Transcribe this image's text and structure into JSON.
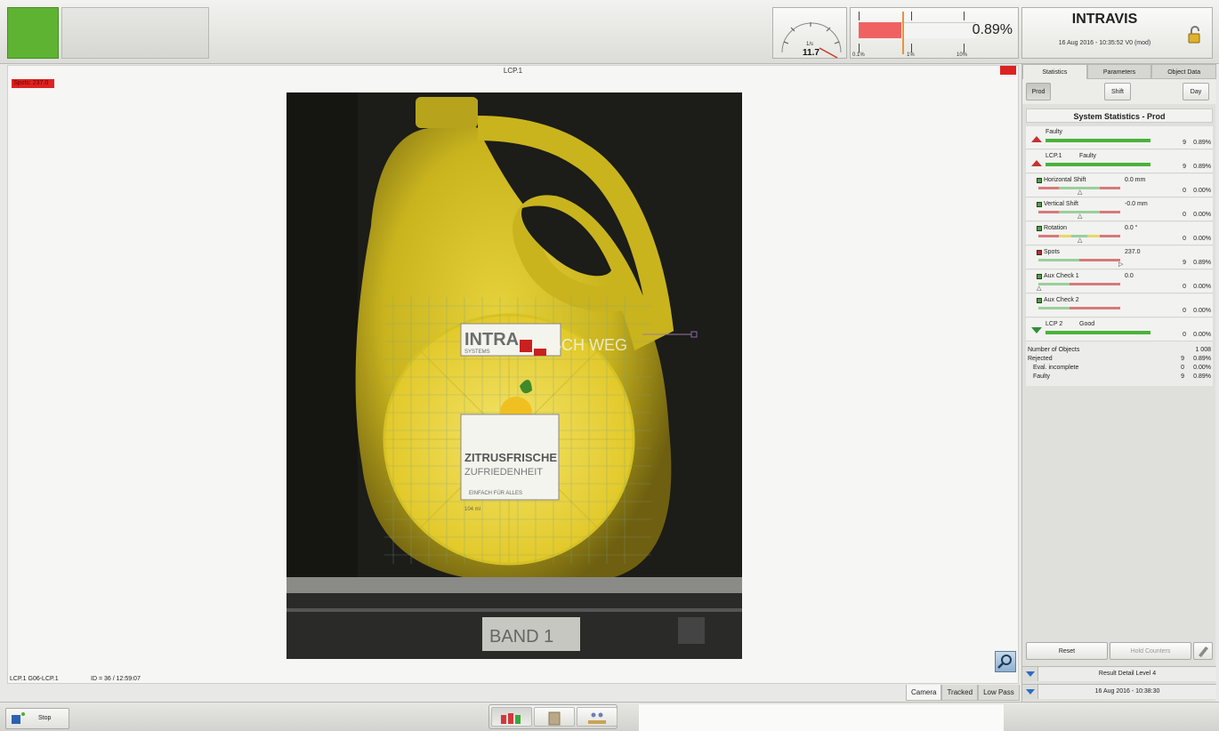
{
  "header": {
    "gauge": {
      "unit": "1/s",
      "value": "11.7"
    },
    "reject_rate": {
      "value": "0.89%",
      "scale": [
        "0.1%",
        "1%",
        "10%"
      ]
    },
    "brand": "INTRAVIS",
    "datetime": "16 Aug 2016 - 10:35:52",
    "version": "V0 (mod)"
  },
  "view": {
    "title": "LCP.1",
    "spots_tag": "Spots: 237.0",
    "footer_left": "LCP.1 G06-LCP.1",
    "footer_id": "ID = 36 / 12:59:07",
    "tabs": [
      "Camera",
      "Tracked",
      "Low Pass"
    ],
    "active_tab": "Camera"
  },
  "camera_image": {
    "label_brand": "INTRA",
    "label_text1": "ZITRUSFRISCHE",
    "label_text2": "ZUFRIEDENHEIT",
    "label_text3": "EINFACH FÜR ALLES",
    "label_volume": "104 ml",
    "label_title_right": "FRISCH WEG",
    "label_sub": "SYSTEMS",
    "band": "BAND 1"
  },
  "sidebar": {
    "tabs": [
      "Statistics",
      "Parameters",
      "Object Data"
    ],
    "active_tab": "Statistics",
    "periods": [
      "Prod",
      "Shift",
      "Day"
    ],
    "active_period": "Prod",
    "stats_title": "System Statistics - Prod",
    "rows": [
      {
        "label": "Faulty",
        "extra": "",
        "value": "",
        "count": "9",
        "pct": "0.89%",
        "kind": "up"
      },
      {
        "label": "LCP.1",
        "extra": "Faulty",
        "value": "",
        "count": "9",
        "pct": "0.89%",
        "kind": "up"
      },
      {
        "label": "Horizontal Shift",
        "extra": "",
        "value": "0.0 mm",
        "count": "0",
        "pct": "0.00%",
        "kind": "ok"
      },
      {
        "label": "Vertical Shift",
        "extra": "",
        "value": "-0.0 mm",
        "count": "0",
        "pct": "0.00%",
        "kind": "ok"
      },
      {
        "label": "Rotation",
        "extra": "",
        "value": "0.0 °",
        "count": "0",
        "pct": "0.00%",
        "kind": "ok"
      },
      {
        "label": "Spots",
        "extra": "",
        "value": "237.0",
        "count": "9",
        "pct": "0.89%",
        "kind": "fail"
      },
      {
        "label": "Aux Check 1",
        "extra": "",
        "value": "0.0",
        "count": "0",
        "pct": "0.00%",
        "kind": "ok"
      },
      {
        "label": "Aux Check 2",
        "extra": "",
        "value": "",
        "count": "0",
        "pct": "0.00%",
        "kind": "ok"
      },
      {
        "label": "LCP 2",
        "extra": "Good",
        "value": "",
        "count": "0",
        "pct": "0.00%",
        "kind": "down"
      }
    ],
    "summary": {
      "objects_label": "Number of Objects",
      "objects": "1 008",
      "rejected_label": "Rejected",
      "rejected_count": "9",
      "rejected_pct": "0.89%",
      "eval_label": "Eval. incomplete",
      "eval_count": "0",
      "eval_pct": "0.00%",
      "faulty_label": "Faulty",
      "faulty_count": "9",
      "faulty_pct": "0.89%"
    },
    "reset_label": "Reset",
    "hold_label": "Hold Counters",
    "detail_level": "Result Detail Level 4",
    "detail_datetime": "16 Aug 2016 - 10:38:30"
  },
  "bottombar": {
    "stop_label": "Stop"
  },
  "colors": {
    "ok": "#5fb332",
    "alarm": "#dd2222",
    "accent": "#2a6cc4"
  }
}
